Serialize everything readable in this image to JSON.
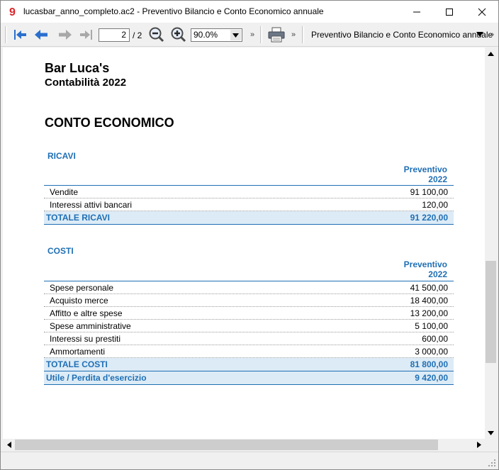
{
  "window": {
    "title": "lucasbar_anno_completo.ac2 - Preventivo Bilancio e Conto Economico annuale"
  },
  "toolbar": {
    "page_current": "2",
    "page_total": "/ 2",
    "zoom": "90.0%",
    "more": "»",
    "report_name": "Preventivo Bilancio e Conto Economico annuale"
  },
  "icons": {
    "first": "first-page-icon",
    "prev": "previous-page-icon",
    "next": "next-page-icon",
    "last": "last-page-icon",
    "zoom_out": "zoom-out-icon",
    "zoom_in": "zoom-in-icon",
    "print": "print-icon"
  },
  "colors": {
    "accent": "#1f6fb5",
    "total_bg": "#dcebf6"
  },
  "document": {
    "company": "Bar Luca's",
    "subtitle": "Contabilità 2022",
    "title": "CONTO ECONOMICO",
    "ricavi": {
      "heading": "RICAVI",
      "col_line1": "Preventivo",
      "col_line2": "2022",
      "rows": [
        {
          "label": "Vendite",
          "value": "91 100,00"
        },
        {
          "label": "Interessi attivi bancari",
          "value": "120,00"
        }
      ],
      "total_label": "TOTALE RICAVI",
      "total_value": "91 220,00"
    },
    "costi": {
      "heading": "COSTI",
      "col_line1": "Preventivo",
      "col_line2": "2022",
      "rows": [
        {
          "label": "Spese personale",
          "value": "41 500,00"
        },
        {
          "label": "Acquisto merce",
          "value": "18 400,00"
        },
        {
          "label": "Affitto e altre spese",
          "value": "13 200,00"
        },
        {
          "label": "Spese amministrative",
          "value": "5 100,00"
        },
        {
          "label": "Interessi su prestiti",
          "value": "600,00"
        },
        {
          "label": "Ammortamenti",
          "value": "3 000,00"
        }
      ],
      "total_label": "TOTALE COSTI",
      "total_value": "81 800,00"
    },
    "result_label": "Utile / Perdita d'esercizio",
    "result_value": "9 420,00"
  }
}
